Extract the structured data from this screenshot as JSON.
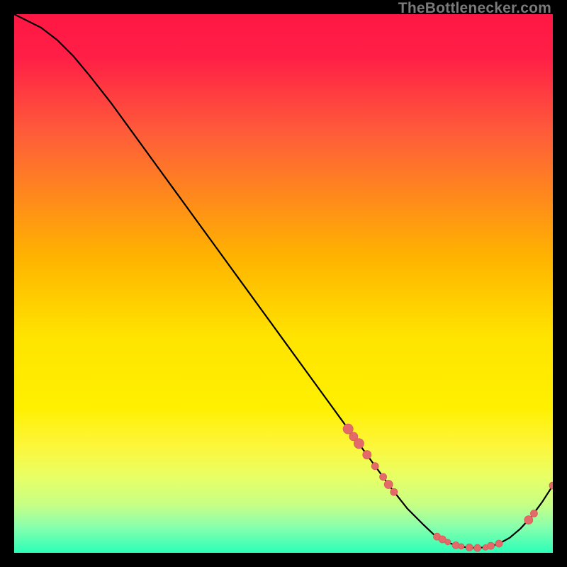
{
  "watermark": "TheBottlenecker.com",
  "chart_data": {
    "type": "line",
    "title": "",
    "xlabel": "",
    "ylabel": "",
    "xlim": [
      0,
      100
    ],
    "ylim": [
      0,
      100
    ],
    "background_gradient": [
      {
        "stop": 0.0,
        "color": "#ff1744"
      },
      {
        "stop": 0.08,
        "color": "#ff1f46"
      },
      {
        "stop": 0.22,
        "color": "#ff5c3a"
      },
      {
        "stop": 0.45,
        "color": "#ffb300"
      },
      {
        "stop": 0.6,
        "color": "#ffe400"
      },
      {
        "stop": 0.73,
        "color": "#fff000"
      },
      {
        "stop": 0.8,
        "color": "#fdf63a"
      },
      {
        "stop": 0.86,
        "color": "#e8ff66"
      },
      {
        "stop": 0.91,
        "color": "#c7ff84"
      },
      {
        "stop": 0.95,
        "color": "#8bffab"
      },
      {
        "stop": 1.0,
        "color": "#2bffb9"
      }
    ],
    "series": [
      {
        "name": "bottleneck-curve",
        "stroke": "#000000",
        "x": [
          0,
          2,
          5,
          8,
          11,
          14,
          18,
          22,
          26,
          30,
          34,
          38,
          42,
          46,
          50,
          54,
          58,
          62,
          66,
          70,
          73,
          76,
          78,
          80,
          82,
          84,
          86,
          88,
          90,
          92,
          94,
          96,
          98,
          100
        ],
        "y": [
          100,
          99,
          97.5,
          95.2,
          92.2,
          88.6,
          83.5,
          78,
          72.5,
          67,
          61.5,
          56,
          50.5,
          45,
          39.5,
          34,
          28.5,
          23,
          17.5,
          12,
          8.2,
          5.2,
          3.3,
          2.1,
          1.4,
          1.0,
          0.9,
          1.1,
          1.7,
          2.8,
          4.5,
          6.7,
          9.4,
          12.5
        ]
      }
    ],
    "markers": {
      "name": "highlight-points",
      "fill": "#e46a6a",
      "stroke": "#d85a5a",
      "radius": 5,
      "points": [
        {
          "x": 62,
          "y": 23.0,
          "r": 7
        },
        {
          "x": 63,
          "y": 21.6,
          "r": 6
        },
        {
          "x": 64,
          "y": 20.3,
          "r": 7
        },
        {
          "x": 65.5,
          "y": 18.2,
          "r": 6
        },
        {
          "x": 67,
          "y": 16.1,
          "r": 5
        },
        {
          "x": 68.5,
          "y": 14.1,
          "r": 5
        },
        {
          "x": 69.5,
          "y": 12.7,
          "r": 6
        },
        {
          "x": 70.5,
          "y": 11.3,
          "r": 5
        },
        {
          "x": 78.5,
          "y": 3.0,
          "r": 5
        },
        {
          "x": 79.5,
          "y": 2.5,
          "r": 5
        },
        {
          "x": 80.5,
          "y": 2.0,
          "r": 4
        },
        {
          "x": 82.0,
          "y": 1.4,
          "r": 5
        },
        {
          "x": 83.0,
          "y": 1.2,
          "r": 4
        },
        {
          "x": 84.5,
          "y": 1.0,
          "r": 5
        },
        {
          "x": 86.0,
          "y": 0.9,
          "r": 5
        },
        {
          "x": 87.5,
          "y": 1.0,
          "r": 4
        },
        {
          "x": 88.5,
          "y": 1.3,
          "r": 5
        },
        {
          "x": 90.0,
          "y": 1.7,
          "r": 5
        },
        {
          "x": 95.5,
          "y": 6.1,
          "r": 6
        },
        {
          "x": 96.5,
          "y": 7.3,
          "r": 5
        },
        {
          "x": 100.0,
          "y": 12.5,
          "r": 5
        }
      ]
    }
  }
}
